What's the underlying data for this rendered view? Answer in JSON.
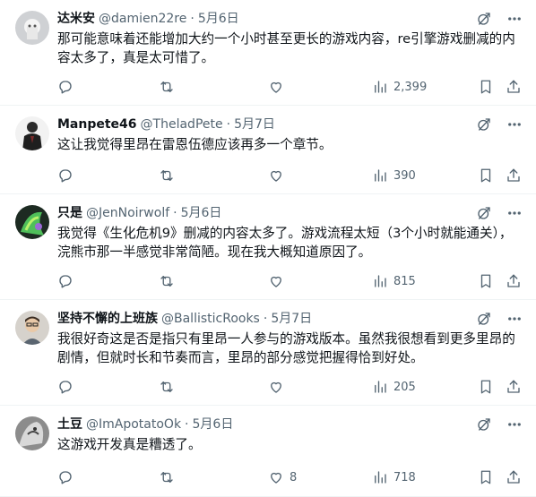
{
  "tweets": [
    {
      "name": "达米安",
      "handle": "@damien22re",
      "separator": "·",
      "date": "5月6日",
      "text": "那可能意味着还能增加大约一个小时甚至更长的游戏内容，re引擎游戏删减的内容太多了，真是太可惜了。",
      "likes": "",
      "views": "2,399"
    },
    {
      "name": "Manpete46",
      "handle": "@TheladPete",
      "separator": "·",
      "date": "5月7日",
      "text": "这让我觉得里昂在雷恩伍德应该再多一个章节。",
      "likes": "",
      "views": "390"
    },
    {
      "name": "只是",
      "handle": "@JenNoirwolf",
      "separator": "·",
      "date": "5月6日",
      "text": "我觉得《生化危机9》删减的内容太多了。游戏流程太短（3个小时就能通关），浣熊市那一半感觉非常简陋。现在我大概知道原因了。",
      "likes": "",
      "views": "815"
    },
    {
      "name": "坚持不懈的上班族",
      "handle": "@BallisticRooks",
      "separator": "·",
      "date": "5月7日",
      "text": "我很好奇这是否是指只有里昂一人参与的游戏版本。虽然我很想看到更多里昂的剧情，但就时长和节奏而言，里昂的部分感觉把握得恰到好处。",
      "likes": "",
      "views": "205"
    },
    {
      "name": "土豆",
      "handle": "@ImApotatoOk",
      "separator": "·",
      "date": "5月6日",
      "text": "这游戏开发真是糟透了。",
      "likes": "8",
      "views": "718"
    }
  ],
  "icons": {
    "grok": "grok-icon",
    "more": "more-icon",
    "reply": "reply-icon",
    "retweet": "retweet-icon",
    "like": "like-icon",
    "views": "views-icon",
    "bookmark": "bookmark-icon",
    "share": "share-icon"
  },
  "colors": {
    "text": "#0f1419",
    "secondary": "#536471",
    "divider": "#eff3f4"
  }
}
